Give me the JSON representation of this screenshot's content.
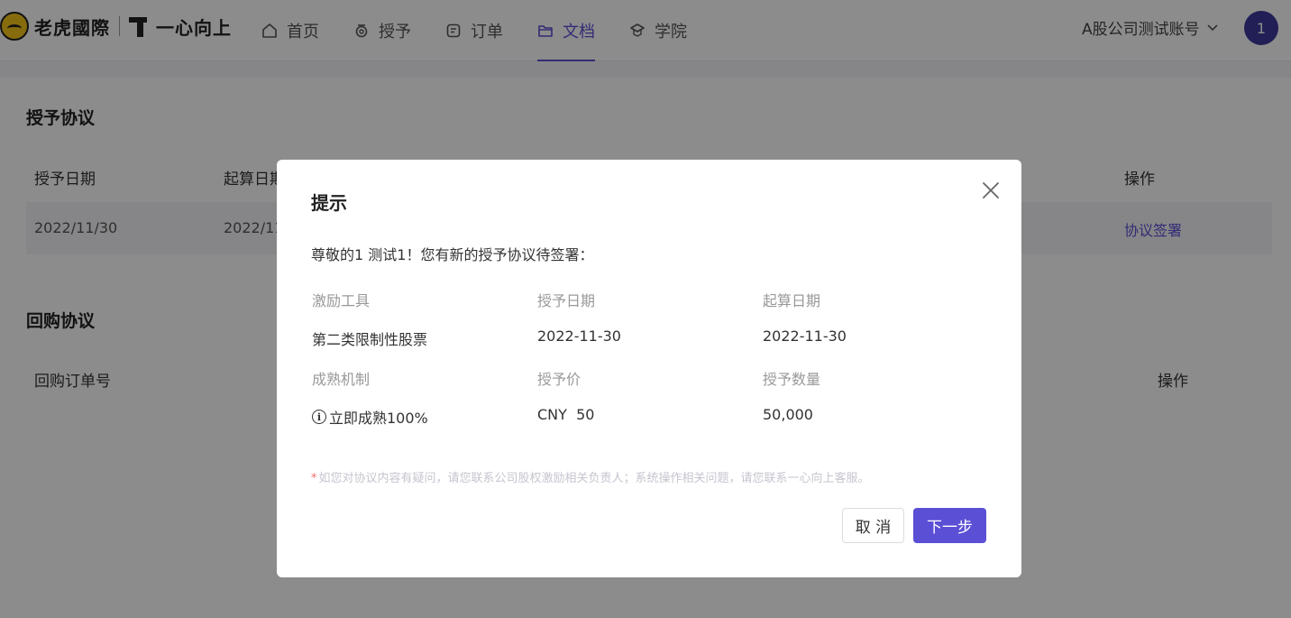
{
  "brand": {
    "company": "老虎國際",
    "product": "一心向上"
  },
  "nav": [
    {
      "label": "首页",
      "icon": "home-icon"
    },
    {
      "label": "授予",
      "icon": "grant-icon"
    },
    {
      "label": "订单",
      "icon": "order-icon"
    },
    {
      "label": "文档",
      "icon": "folder-icon",
      "active": true
    },
    {
      "label": "学院",
      "icon": "academy-icon"
    }
  ],
  "account": {
    "name": "A股公司测试账号",
    "avatar_text": "1"
  },
  "grant_section": {
    "title": "授予协议",
    "headers": [
      "授予日期",
      "起算日期",
      "操作"
    ],
    "row": {
      "grant_date": "2022/11/30",
      "start_date": "2022/11",
      "action": "协议签署"
    }
  },
  "buyback_section": {
    "title": "回购协议",
    "headers": [
      "回购订单号",
      "操作"
    ]
  },
  "modal": {
    "title": "提示",
    "greeting": "尊敬的1 测试1！您有新的授予协议待签署：",
    "labels": [
      "激励工具",
      "授予日期",
      "起算日期",
      "成熟机制",
      "授予价",
      "授予数量"
    ],
    "values": {
      "tool": "第二类限制性股票",
      "grant_date": "2022-11-30",
      "start_date": "2022-11-30",
      "vesting": "立即成熟100%",
      "price": "CNY  50",
      "quantity": "50,000"
    },
    "note_star": "*",
    "note": "如您对协议内容有疑问，请您联系公司股权激励相关负责人；系统操作相关问题，请您联系一心向上客服。",
    "cancel_label": "取 消",
    "next_label": "下一步"
  },
  "colors": {
    "accent": "#5b4fd6",
    "avatar": "#3d3a9c",
    "brand_yellow": "#f5c518"
  }
}
